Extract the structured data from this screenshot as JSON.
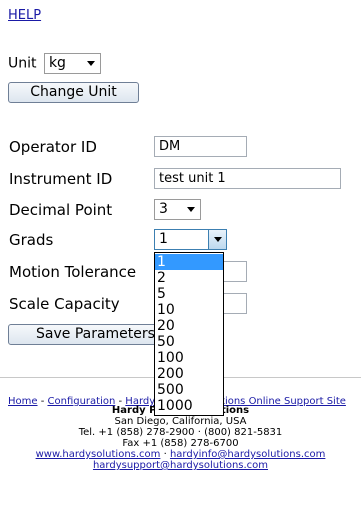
{
  "help_link": "HELP",
  "unit": {
    "label": "Unit",
    "selected": "kg",
    "button": "Change Unit"
  },
  "fields": {
    "operator_id": {
      "label": "Operator ID",
      "value": "DM"
    },
    "instrument_id": {
      "label": "Instrument ID",
      "value": "test unit 1"
    },
    "decimal_point": {
      "label": "Decimal Point",
      "value": "3"
    },
    "grads": {
      "label": "Grads",
      "value": "1"
    },
    "motion_tolerance": {
      "label": "Motion Tolerance",
      "value": ""
    },
    "scale_capacity": {
      "label": "Scale Capacity",
      "value": ""
    }
  },
  "save_button": "Save Parameters",
  "grads_dropdown": {
    "options": [
      "1",
      "2",
      "5",
      "10",
      "20",
      "50",
      "100",
      "200",
      "500",
      "1000"
    ],
    "highlighted": "1"
  },
  "footer": {
    "links": {
      "home": "Home",
      "sep1": " - ",
      "configuration": "Configuration",
      "sep2": " - ",
      "hardy": "Hardy Process Solutions Online Support Site"
    },
    "company": "Hardy Process Solutions",
    "address": "San Diego, California, USA",
    "phone": "Tel. +1 (858) 278-2900 · (800) 821-5831",
    "fax": "Fax +1 (858) 278-6700",
    "website": "www.hardysolutions.com",
    "sep": " · ",
    "info_email": "hardyinfo@hardysolutions.com",
    "support_email": "hardysupport@hardysolutions.com"
  }
}
